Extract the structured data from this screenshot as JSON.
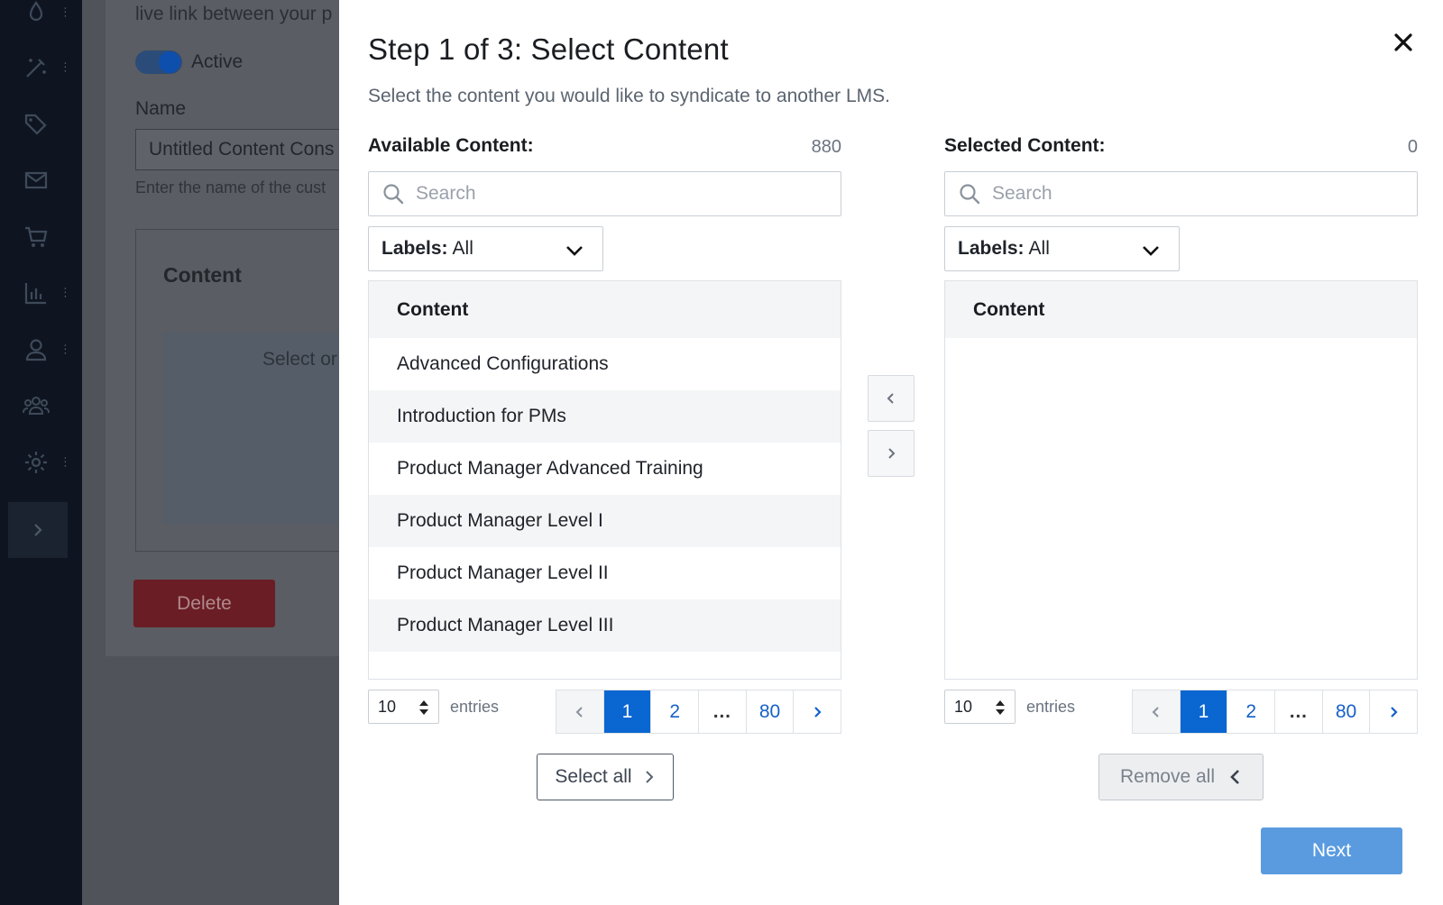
{
  "sidebar": {
    "icons": [
      "drop-icon",
      "magic-wand-icon",
      "tags-icon",
      "mail-icon",
      "cart-icon",
      "bar-chart-icon",
      "user-icon",
      "group-icon",
      "gear-icon"
    ],
    "expand_icon": "chevron-right-icon"
  },
  "background": {
    "intro_text": "live link between your p",
    "toggle_label": "Active",
    "name_label": "Name",
    "name_value": "Untitled Content Cons",
    "name_help": "Enter the name of the cust",
    "content_heading": "Content",
    "drop_text": "Select or",
    "delete_label": "Delete"
  },
  "modal": {
    "title": "Step 1 of 3: Select Content",
    "subtitle": "Select the content you would like to syndicate to another LMS.",
    "close_icon": "close-icon",
    "available": {
      "title": "Available Content:",
      "count": "880",
      "search_placeholder": "Search",
      "labels_key": "Labels:",
      "labels_value": "All",
      "column_header": "Content",
      "rows": [
        "Advanced Configurations",
        "Introduction for PMs",
        "Product Manager Advanced Training",
        "Product Manager Level I",
        "Product Manager Level II",
        "Product Manager Level III"
      ],
      "entries_value": "10",
      "entries_label": "entries",
      "pages": [
        "1",
        "2",
        "…",
        "80"
      ],
      "active_page": "1",
      "action_label": "Select all"
    },
    "selected": {
      "title": "Selected Content:",
      "count": "0",
      "search_placeholder": "Search",
      "labels_key": "Labels:",
      "labels_value": "All",
      "column_header": "Content",
      "rows": [],
      "entries_value": "10",
      "entries_label": "entries",
      "pages": [
        "1",
        "2",
        "…",
        "80"
      ],
      "active_page": "1",
      "action_label": "Remove all"
    },
    "next_label": "Next"
  },
  "colors": {
    "primary": "#0a66d1",
    "next_button": "#5a9be0",
    "sidebar_bg": "#0e1520",
    "delete_bg": "#6a1d24"
  }
}
